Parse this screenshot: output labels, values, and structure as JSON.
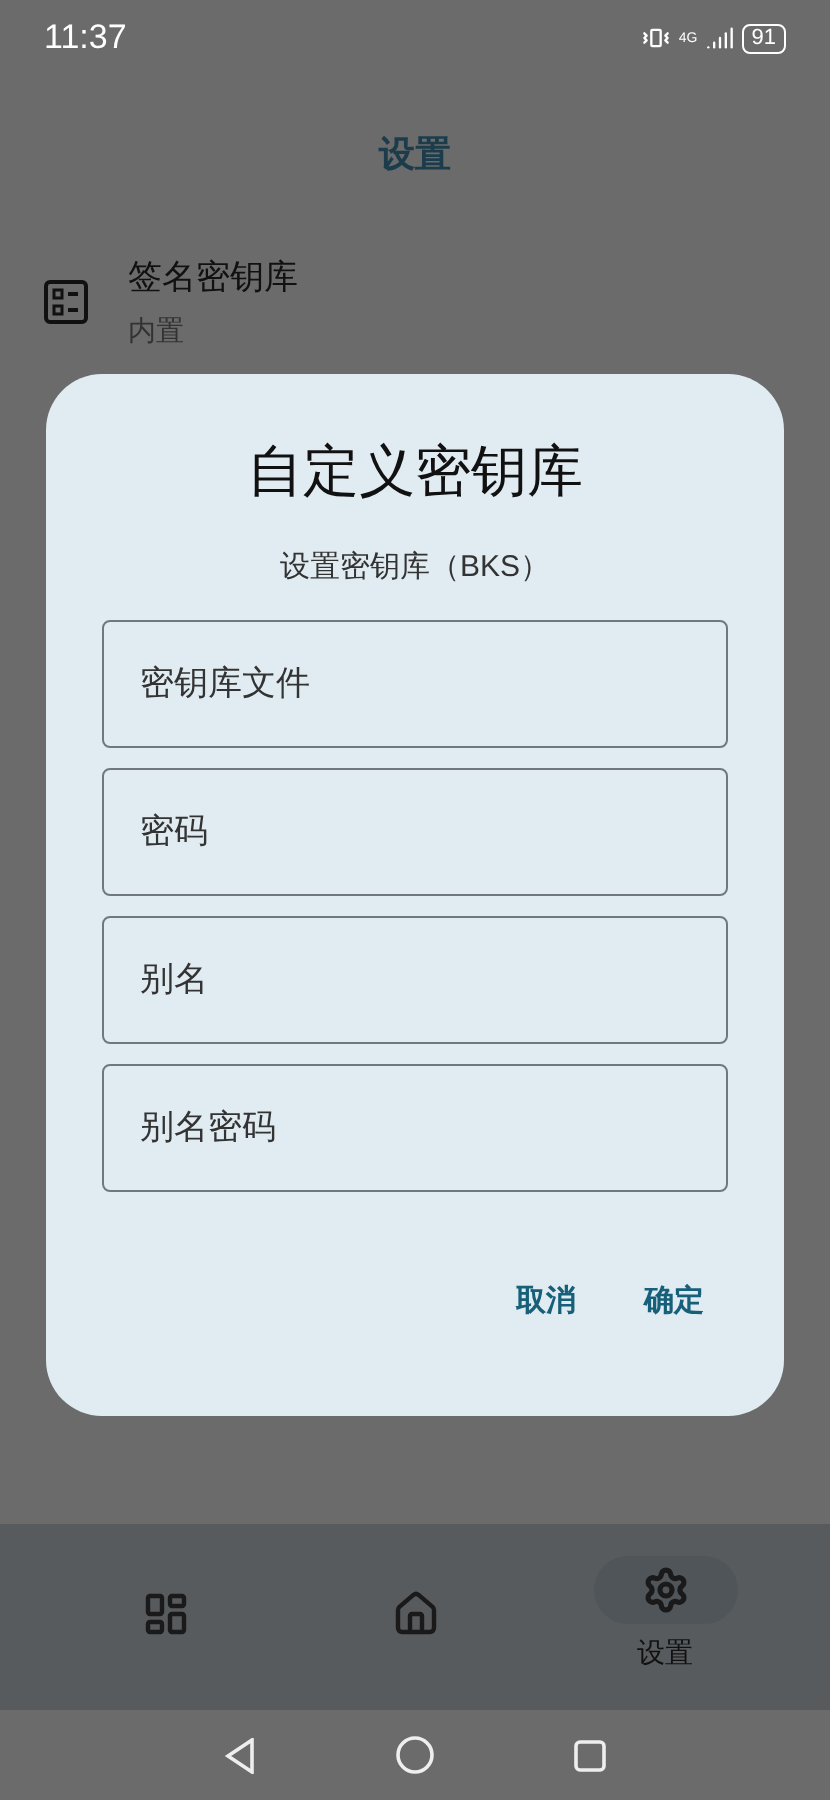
{
  "status_bar": {
    "time": "11:37",
    "battery": "91",
    "network": "4G"
  },
  "app_bar": {
    "title": "设置"
  },
  "settings": [
    {
      "title": "签名密钥库",
      "subtitle": "内置"
    }
  ],
  "dialog": {
    "title": "自定义密钥库",
    "subtitle": "设置密钥库（BKS）",
    "fields": [
      {
        "placeholder": "密钥库文件"
      },
      {
        "placeholder": "密码"
      },
      {
        "placeholder": "别名"
      },
      {
        "placeholder": "别名密码"
      }
    ],
    "buttons": [
      "取消",
      "确定"
    ]
  },
  "bottom_nav": [
    {
      "kind": "dashboard",
      "selected": false
    },
    {
      "kind": "home",
      "selected": false
    },
    {
      "kind": "settings",
      "label": "设置",
      "selected": true
    }
  ]
}
